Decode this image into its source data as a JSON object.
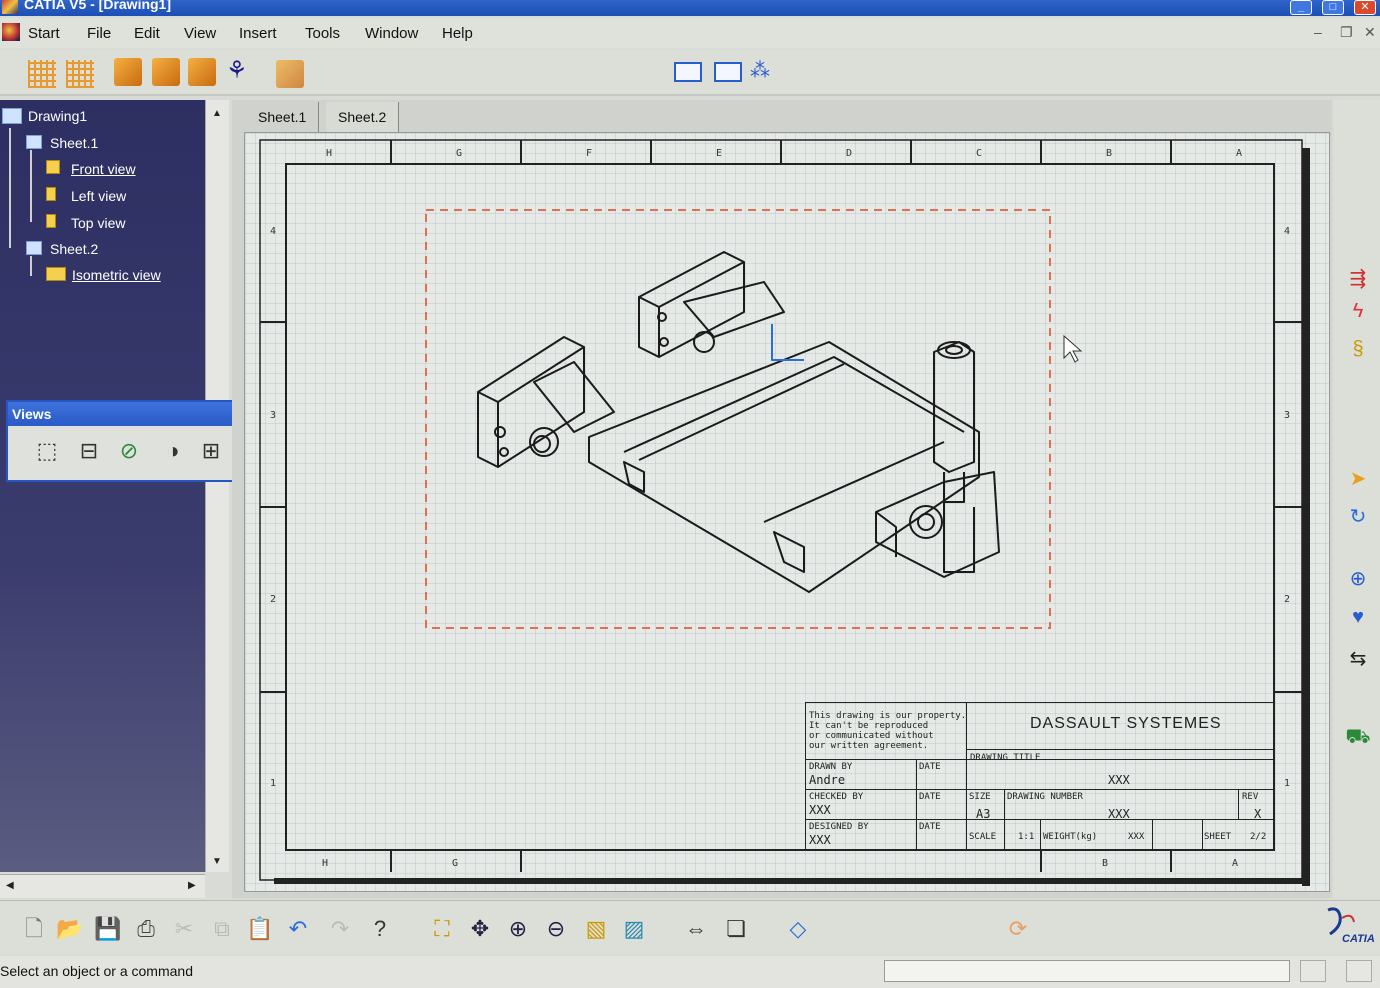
{
  "window": {
    "title": "CATIA V5 - [Drawing1]",
    "controls": [
      "_",
      "□",
      "✕"
    ]
  },
  "menu": {
    "items": [
      "Start",
      "File",
      "Edit",
      "View",
      "Insert",
      "Tools",
      "Window",
      "Help"
    ],
    "mdi_controls": [
      "–",
      "❐",
      "✕"
    ]
  },
  "tree": {
    "root": "Drawing1",
    "sheet1": "Sheet.1",
    "front_view": "Front view",
    "left_view": "Left view",
    "top_view": "Top view",
    "sheet2": "Sheet.2",
    "isometric_view": "Isometric view"
  },
  "views_toolbar": {
    "title": "Views",
    "close": "✕"
  },
  "tabs": [
    "Sheet.1",
    "Sheet.2"
  ],
  "sheet": {
    "col_labels_top": [
      "H",
      "G",
      "F",
      "E",
      "D",
      "C",
      "B",
      "A"
    ],
    "col_labels_bottom": [
      "H",
      "G",
      "B",
      "A"
    ],
    "row_labels_left": [
      "4",
      "3",
      "2",
      "1"
    ],
    "row_labels_right": [
      "4",
      "3",
      "2",
      "1"
    ]
  },
  "title_block": {
    "notice": [
      "This drawing is our property.",
      "It can't be reproduced",
      "or communicated without",
      "our written agreement."
    ],
    "company": "DASSAULT SYSTEMES",
    "drawing_title_label": "DRAWING TITLE",
    "drawing_title_value": "XXX",
    "drawn_by_label": "DRAWN BY",
    "drawn_by_value": "Andre",
    "checked_by_label": "CHECKED BY",
    "checked_by_value": "XXX",
    "designed_by_label": "DESIGNED BY",
    "designed_by_value": "XXX",
    "date_label": "DATE",
    "size_label": "SIZE",
    "size_value": "A3",
    "drawing_number_label": "DRAWING NUMBER",
    "drawing_number_value": "XXX",
    "rev_label": "REV",
    "rev_value": "X",
    "scale_label": "SCALE",
    "scale_value": "1:1",
    "weight_label": "WEIGHT(kg)",
    "weight_value": "XXX",
    "sheet_label": "SHEET",
    "sheet_value": "2/2"
  },
  "status": {
    "message": "Select an object or a command"
  },
  "logo": {
    "text": "CATIA"
  },
  "colors": {
    "tree_bg": "#2d2f62",
    "title_bar": "#2f64c8",
    "frame_dash": "#e07050"
  }
}
